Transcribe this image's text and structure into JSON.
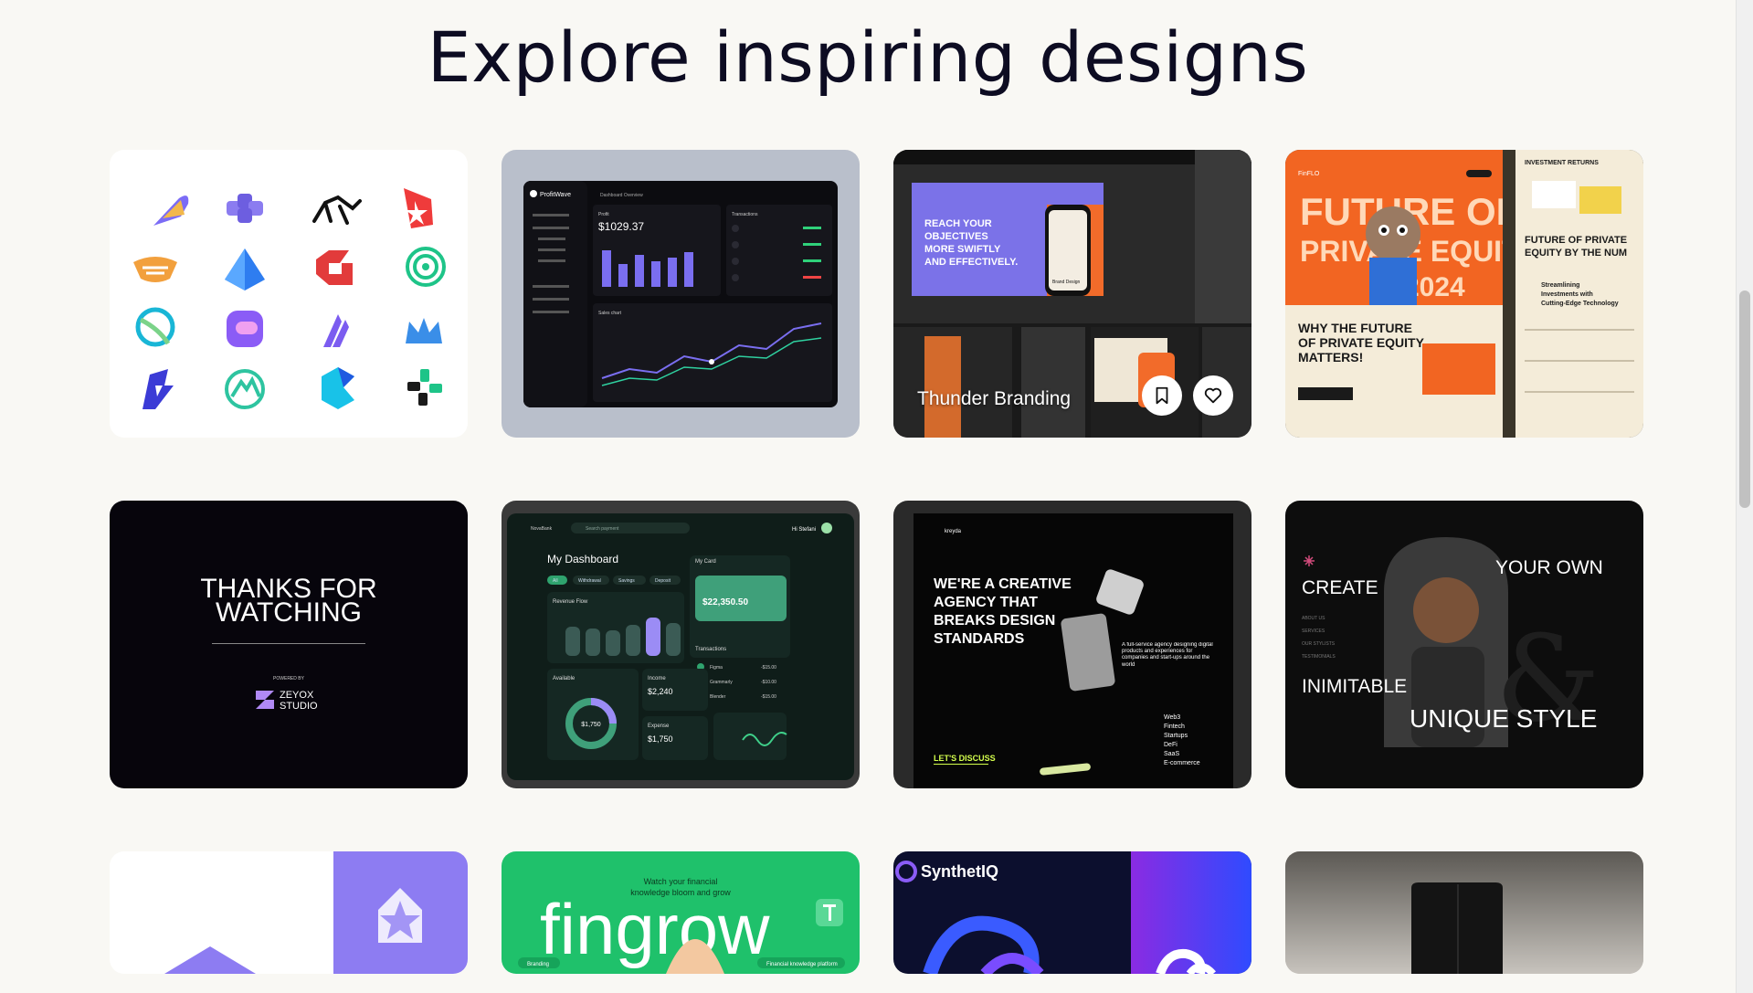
{
  "page": {
    "heading": "Explore inspiring designs"
  },
  "cards": [
    {
      "label": "Logo collection"
    },
    {
      "app": "ProfitWave",
      "section": "Dashboard Overview",
      "profit": "$1029.37",
      "profit_label": "Profit",
      "transactions_label": "Transactions",
      "sales_label": "Sales chart"
    },
    {
      "title": "Thunder Branding",
      "headline_lines": [
        "REACH YOUR",
        "OBJECTIVES",
        "MORE SWIFTLY",
        "AND EFFECTIVELY."
      ],
      "sub": "Brand Design"
    },
    {
      "brand": "FinFLO",
      "hero_lines": [
        "FUTURE OF",
        "PRIVATE EQUITY",
        "2024"
      ],
      "why_lines": [
        "WHY THE FUTURE",
        "OF PRIVATE EQUITY",
        "MATTERS!"
      ],
      "right_head": "INVESTMENT RETURNS",
      "right_title_lines": [
        "FUTURE OF PRIVATE",
        "EQUITY BY THE NUM"
      ],
      "right_sub_lines": [
        "Streamlining",
        "Investments with",
        "Cutting-Edge Technology"
      ]
    },
    {
      "line1": "THANKS FOR",
      "line2": "WATCHING",
      "powered": "POWERED BY",
      "studio_lines": [
        "ZEYOX",
        "STUDIO"
      ]
    },
    {
      "app": "NovaBank",
      "search": "Search payment",
      "greet": "Hi Stefani",
      "heading": "My Dashboard",
      "tabs": [
        "All",
        "Withdrawal",
        "Savings",
        "Deposit"
      ],
      "revenue": "Revenue Flow",
      "card_label": "My Card",
      "balance": "$22,350.50",
      "available": "Available",
      "available_value": "$1,750",
      "income": "Income",
      "income_value": "$2,240",
      "expense": "Expense",
      "expense_value": "$1,750",
      "transactions": "Transactions",
      "tx": [
        "Figma",
        "Grammarly",
        "Blender"
      ],
      "tx_amounts": [
        "-$15.00",
        "-$10.00",
        "-$15.00"
      ]
    },
    {
      "brand": "kreyda",
      "headline_lines": [
        "WE'RE A CREATIVE",
        "AGENCY THAT",
        "BREAKS DESIGN",
        "STANDARDS"
      ],
      "cta": "LET'S DISCUSS",
      "services": [
        "Web3",
        "Fintech",
        "Startups",
        "DeFi",
        "SaaS",
        "E-commerce"
      ],
      "blurb": "A full-service agency designing digital products and experiences for companies and start-ups around the world"
    },
    {
      "top": "YOUR OWN",
      "create": "CREATE",
      "inimitable": "INIMITABLE",
      "style": "UNIQUE STYLE",
      "menu": [
        "ABOUT US",
        "SERVICES",
        "OUR STYLISTS",
        "TESTIMONIALS"
      ]
    },
    {
      "label": "Star house logo"
    },
    {
      "tagline_lines": [
        "Watch your financial",
        "knowledge bloom and grow"
      ],
      "brand": "fingrow",
      "tag": "Branding",
      "tag2": "Financial knowledge platform"
    },
    {
      "brand": "SynthetIQ"
    },
    {
      "label": "Device product shot"
    }
  ],
  "colors": {
    "background": "#f9f8f4",
    "heading": "#0d0c22",
    "accent_orange": "#f2611d",
    "accent_purple": "#7b6cf6",
    "accent_green": "#1fc16b"
  }
}
